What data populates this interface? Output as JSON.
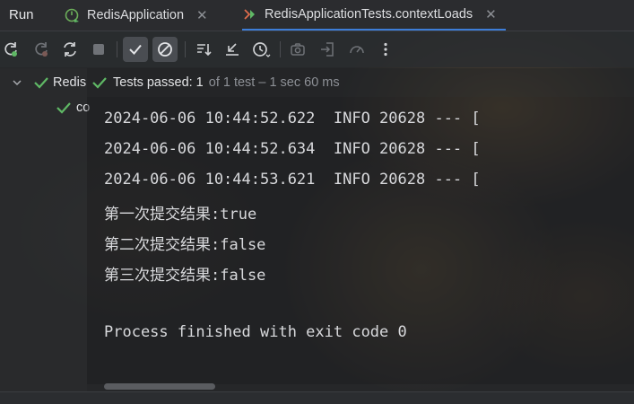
{
  "header": {
    "run_label": "Run",
    "tabs": [
      {
        "label": "RedisApplication",
        "icon": "spring-app-icon"
      },
      {
        "label": "RedisApplicationTests.contextLoads",
        "icon": "test-run-icon"
      }
    ]
  },
  "toolbar": {
    "buttons": [
      "rerun-icon",
      "rerun-failed-icon",
      "toggle-auto-test-icon",
      "stop-icon",
      "show-passed-icon",
      "show-ignored-icon",
      "sort-icon",
      "collapse-icon",
      "history-icon",
      "screenshot-icon",
      "import-icon",
      "coverage-icon",
      "more-options-icon"
    ]
  },
  "tree": {
    "root_label": "Redis",
    "child_label": "co"
  },
  "status": {
    "passed_label": "Tests passed:",
    "passed_count": "1",
    "detail": "of 1 test – 1 sec 60 ms"
  },
  "console": {
    "lines": [
      "2024-06-06 10:44:52.622  INFO 20628 --- [",
      "2024-06-06 10:44:52.634  INFO 20628 --- [",
      "2024-06-06 10:44:53.621  INFO 20628 --- [",
      "第一次提交结果:true",
      "第二次提交结果:false",
      "第三次提交结果:false",
      "",
      "Process finished with exit code 0"
    ]
  },
  "colors": {
    "accent": "#3d7dd8",
    "pass_green": "#5fb865"
  }
}
